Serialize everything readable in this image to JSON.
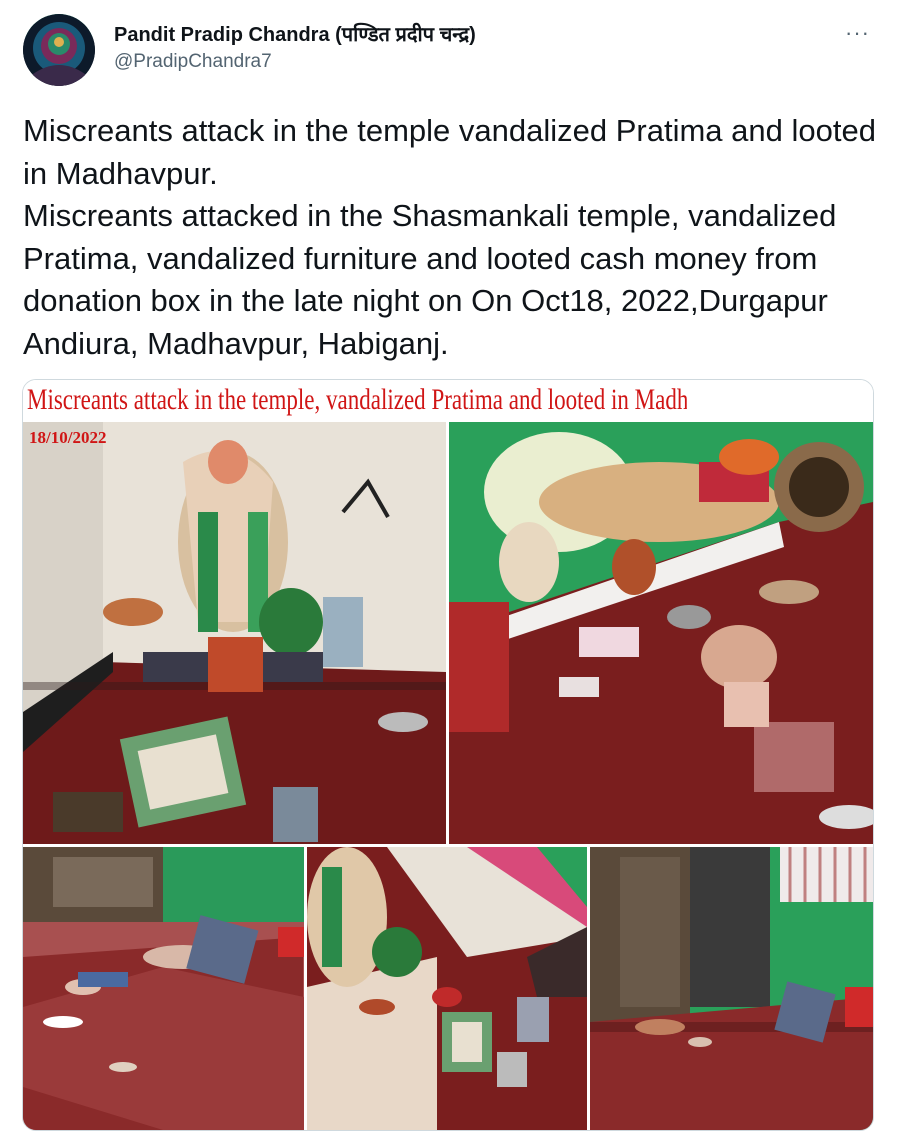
{
  "author": {
    "name": "Pandit Pradip Chandra (पण्डित प्रदीप चन्द्र)",
    "handle": "@PradipChandra7"
  },
  "menu": {
    "more_label": "···"
  },
  "tweet": {
    "lines": [
      "Miscreants attack in the temple vandalized Pratima and looted in Madhavpur.",
      "Miscreants attacked in the Shasmankali temple, vandalized Pratima, vandalized furniture and looted cash money from donation box in the late night on On Oct18, 2022,Durgapur Andiura, Madhavpur, Habiganj."
    ]
  },
  "media": {
    "banner_title": "Miscreants attack in the temple, vandalized Pratima and looted in Madhavpur of Habiganj",
    "date_stamp": "18/10/2022"
  },
  "colors": {
    "banner_red": "#d01515",
    "floor_red": "#6e1a1a",
    "wall_green": "#2a9a5a"
  }
}
